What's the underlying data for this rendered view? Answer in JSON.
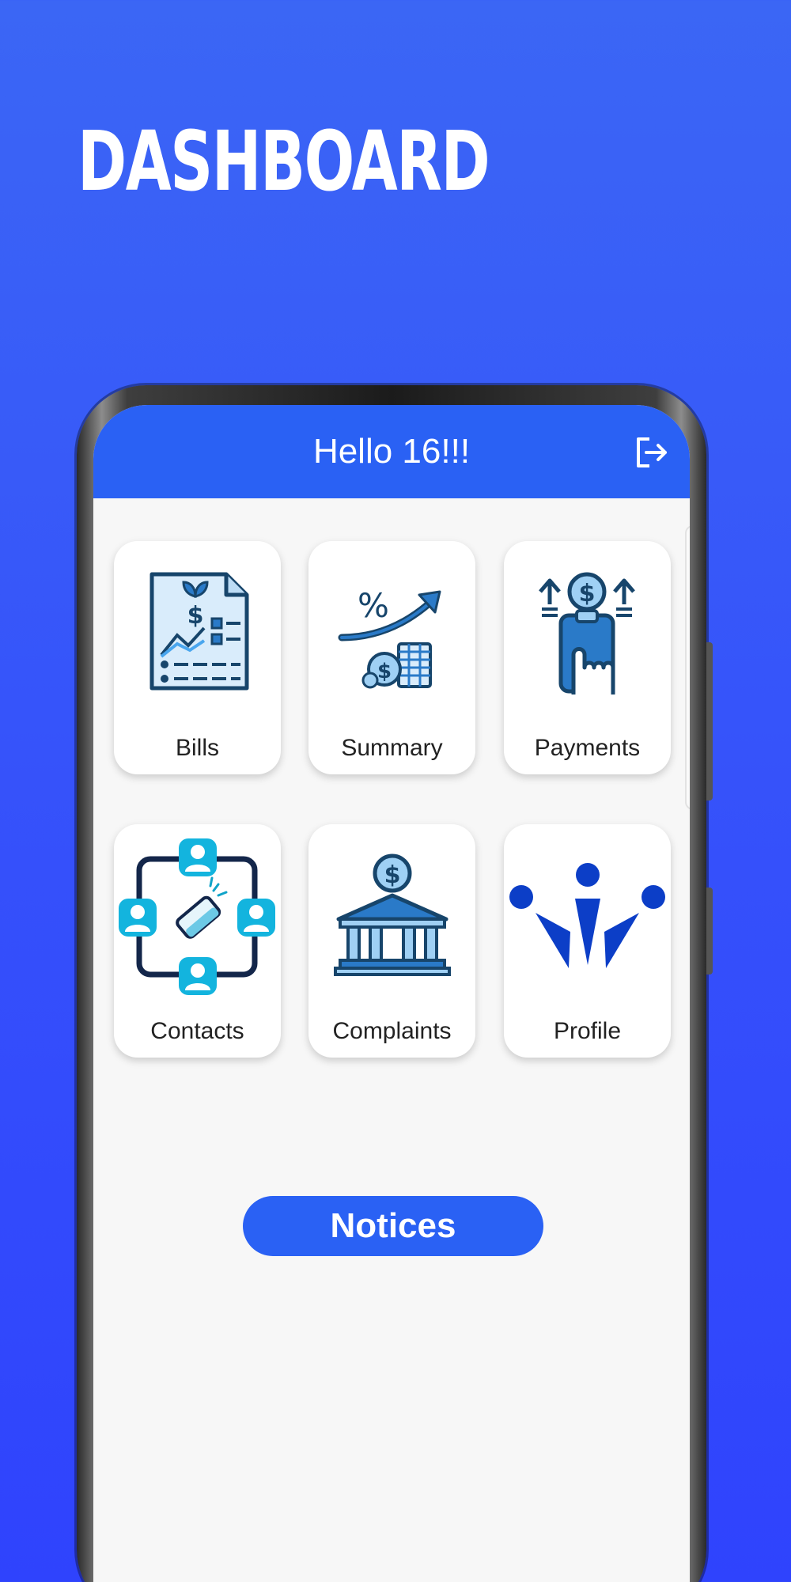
{
  "headline": "DASHBOARD",
  "app_bar": {
    "greeting": "Hello 16!!!",
    "logout_icon": "logout-icon"
  },
  "tiles": [
    {
      "label": "Bills",
      "icon": "bill-document-icon"
    },
    {
      "label": "Summary",
      "icon": "growth-summary-icon"
    },
    {
      "label": "Payments",
      "icon": "phone-payment-icon"
    },
    {
      "label": "Contacts",
      "icon": "contacts-network-icon"
    },
    {
      "label": "Complaints",
      "icon": "bank-building-icon"
    },
    {
      "label": "Profile",
      "icon": "team-profile-icon"
    }
  ],
  "notices_label": "Notices",
  "colors": {
    "background_top": "#3b66f5",
    "background_bottom": "#2f43fd",
    "accent": "#2a61f4",
    "screen": "#f7f7f7"
  }
}
